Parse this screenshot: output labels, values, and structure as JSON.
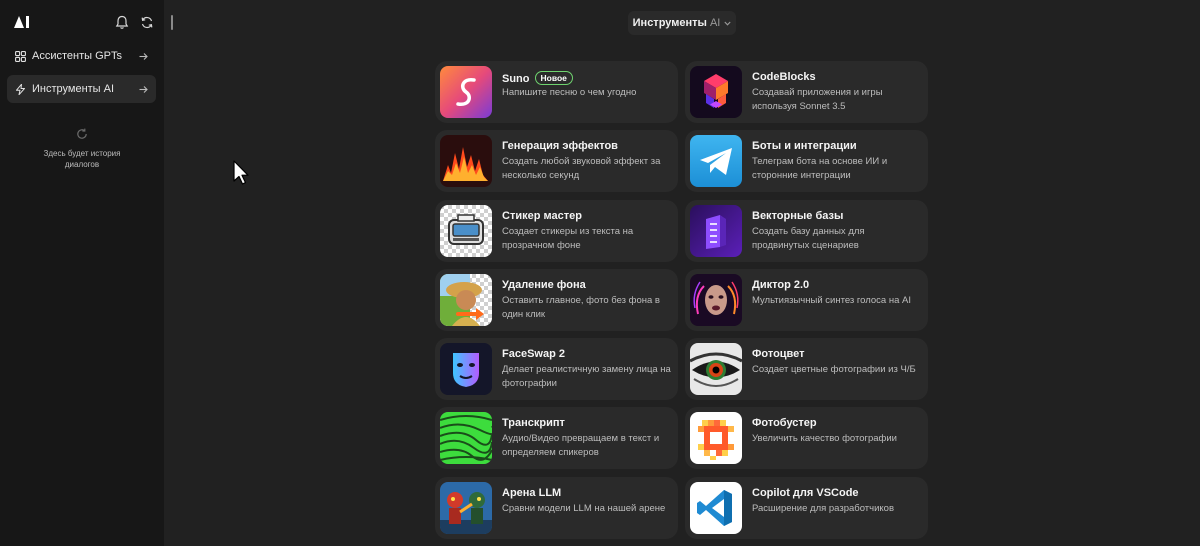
{
  "sidebar": {
    "nav": [
      {
        "label": "Ассистенты GPTs",
        "icon": "grid-icon"
      },
      {
        "label": "Инструменты AI",
        "icon": "bolt-icon"
      }
    ],
    "history_empty_text": "Здесь будет история диалогов"
  },
  "header": {
    "tools_select": {
      "label": "Инструменты",
      "suffix": "AI"
    }
  },
  "tools": [
    {
      "title": "Suno",
      "badge": "Новое",
      "description": "Напишите песню о чем угодно"
    },
    {
      "title": "CodeBlocks",
      "description": "Создавай приложения и игры используя Sonnet 3.5"
    },
    {
      "title": "Генерация эффектов",
      "description": "Создать любой звуковой эффект за несколько секунд"
    },
    {
      "title": "Боты и интеграции",
      "description": "Телеграм бота на основе ИИ и сторонние интеграции"
    },
    {
      "title": "Стикер мастер",
      "description": "Создает стикеры из текста на прозрачном фоне"
    },
    {
      "title": "Векторные базы",
      "description": "Создать базу данных для продвинутых сценариев"
    },
    {
      "title": "Удаление фона",
      "description": "Оставить главное, фото без фона в один клик"
    },
    {
      "title": "Диктор 2.0",
      "description": "Мультиязычный синтез голоса на AI"
    },
    {
      "title": "FaceSwap 2",
      "description": "Делает реалистичную замену лица на фотографии"
    },
    {
      "title": "Фотоцвет",
      "description": "Создает цветные фотографии из Ч/Б"
    },
    {
      "title": "Транскрипт",
      "description": "Аудио/Видео превращаем в текст и определяем спикеров"
    },
    {
      "title": "Фотобустер",
      "description": "Увеличить качество фотографии"
    },
    {
      "title": "Арена LLM",
      "description": "Сравни модели LLM на нашей арене"
    },
    {
      "title": "Copilot для VSCode",
      "description": "Расширение для разработчиков"
    }
  ],
  "colors": {
    "background": "#212121",
    "sidebar": "#171717",
    "card": "#2a2a2a",
    "badge_border": "#6fd36f"
  }
}
